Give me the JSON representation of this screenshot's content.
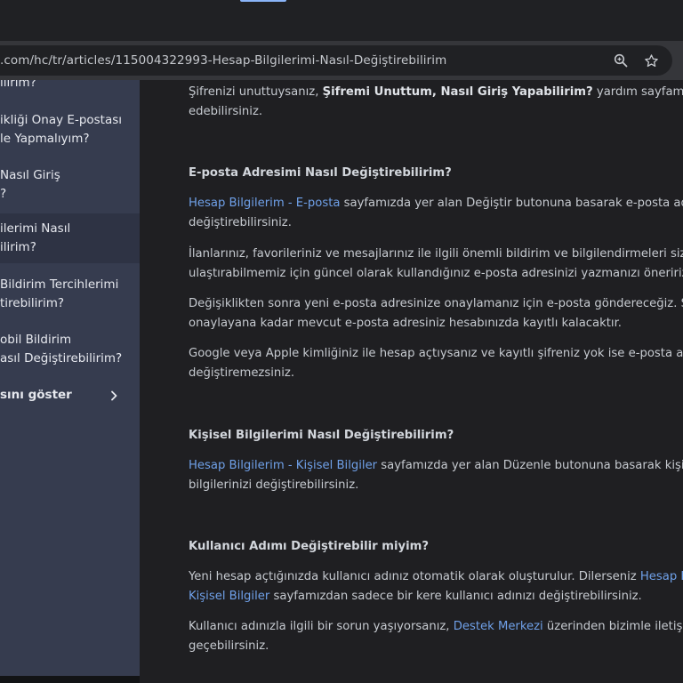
{
  "browser": {
    "url": ".com/hc/tr/articles/115004322993-Hesap-Bilgilerimi-Nasıl-Değiştirebilirim",
    "zoom_icon": "magnifier-zoom-icon",
    "bookmark_icon": "star-icon"
  },
  "sidebar": {
    "items": [
      {
        "line1": "ilirim?",
        "line2": ""
      },
      {
        "line1": "ikliği Onay E-postası",
        "line2": "le Yapmalıyım?"
      },
      {
        "line1": "Nasıl Giriş",
        "line2": "?"
      },
      {
        "line1": "ilerimi Nasıl",
        "line2": "ilirim?"
      },
      {
        "line1": "Bildirim Tercihlerimi",
        "line2": "tirebilirim?"
      },
      {
        "line1": "obil Bildirim",
        "line2": "asıl Değiştirebilirim?"
      }
    ],
    "show_more": "sını göster"
  },
  "article": {
    "intro": {
      "a": "Şifrenizi unuttuysanız, ",
      "b": "Şifremi Unuttum, Nasıl Giriş Yapabilirim?",
      "c": " yardım sayfamızı ziyaret",
      "line2": "edebilirsiniz."
    },
    "email": {
      "heading": "E-posta Adresimi Nasıl Değiştirebilirim?",
      "p1_link": "Hesap Bilgilerim - E-posta",
      "p1_rest": " sayfamızda yer alan Değiştir butonuna basarak e-posta adres",
      "p1_line2": "değiştirebilirsiniz.",
      "p2_line1": "İlanlarınız, favorileriniz ve mesajlarınız ile ilgili önemli bildirim ve bilgilendirmeleri size",
      "p2_line2": "ulaştırabilmemiz için güncel olarak kullandığınız e-posta adresinizi yazmanızı öneririz.",
      "p3_line1": "Değişiklikten sonra yeni e-posta adresinize onaylamanız için e-posta göndereceğiz. Siz",
      "p3_line2": "onaylayana kadar mevcut e-posta adresiniz hesabınızda kayıtlı kalacaktır.",
      "p4_line1": "Google veya Apple kimliğiniz ile hesap açtıysanız ve kayıtlı şifreniz yok ise e-posta adres",
      "p4_line2": "değiştiremezsiniz."
    },
    "personal": {
      "heading": "Kişisel Bilgilerimi Nasıl Değiştirebilirim?",
      "p1_link": "Hesap Bilgilerim - Kişisel Bilgiler",
      "p1_rest": " sayfamızda yer alan Düzenle butonuna basarak kişisel",
      "p1_line2": "bilgilerinizi değiştirebilirsiniz."
    },
    "username": {
      "heading": "Kullanıcı Adımı Değiştirebilir miyim?",
      "p1_a": "Yeni hesap açtığınızda kullanıcı adınız otomatik olarak oluşturulur. Dilerseniz ",
      "p1_link1": "Hesap Bilg",
      "p1_link2": "Kişisel Bilgiler",
      "p1_rest": " sayfamızdan sadece bir kere kullanıcı adınızı değiştirebilirsiniz.",
      "p2_a": "Kullanıcı adınızla ilgili bir sorun yaşıyorsanız, ",
      "p2_link": "Destek Merkezi",
      "p2_rest": " üzerinden bizimle iletişime",
      "p2_line2": "geçebilirsiniz."
    }
  }
}
